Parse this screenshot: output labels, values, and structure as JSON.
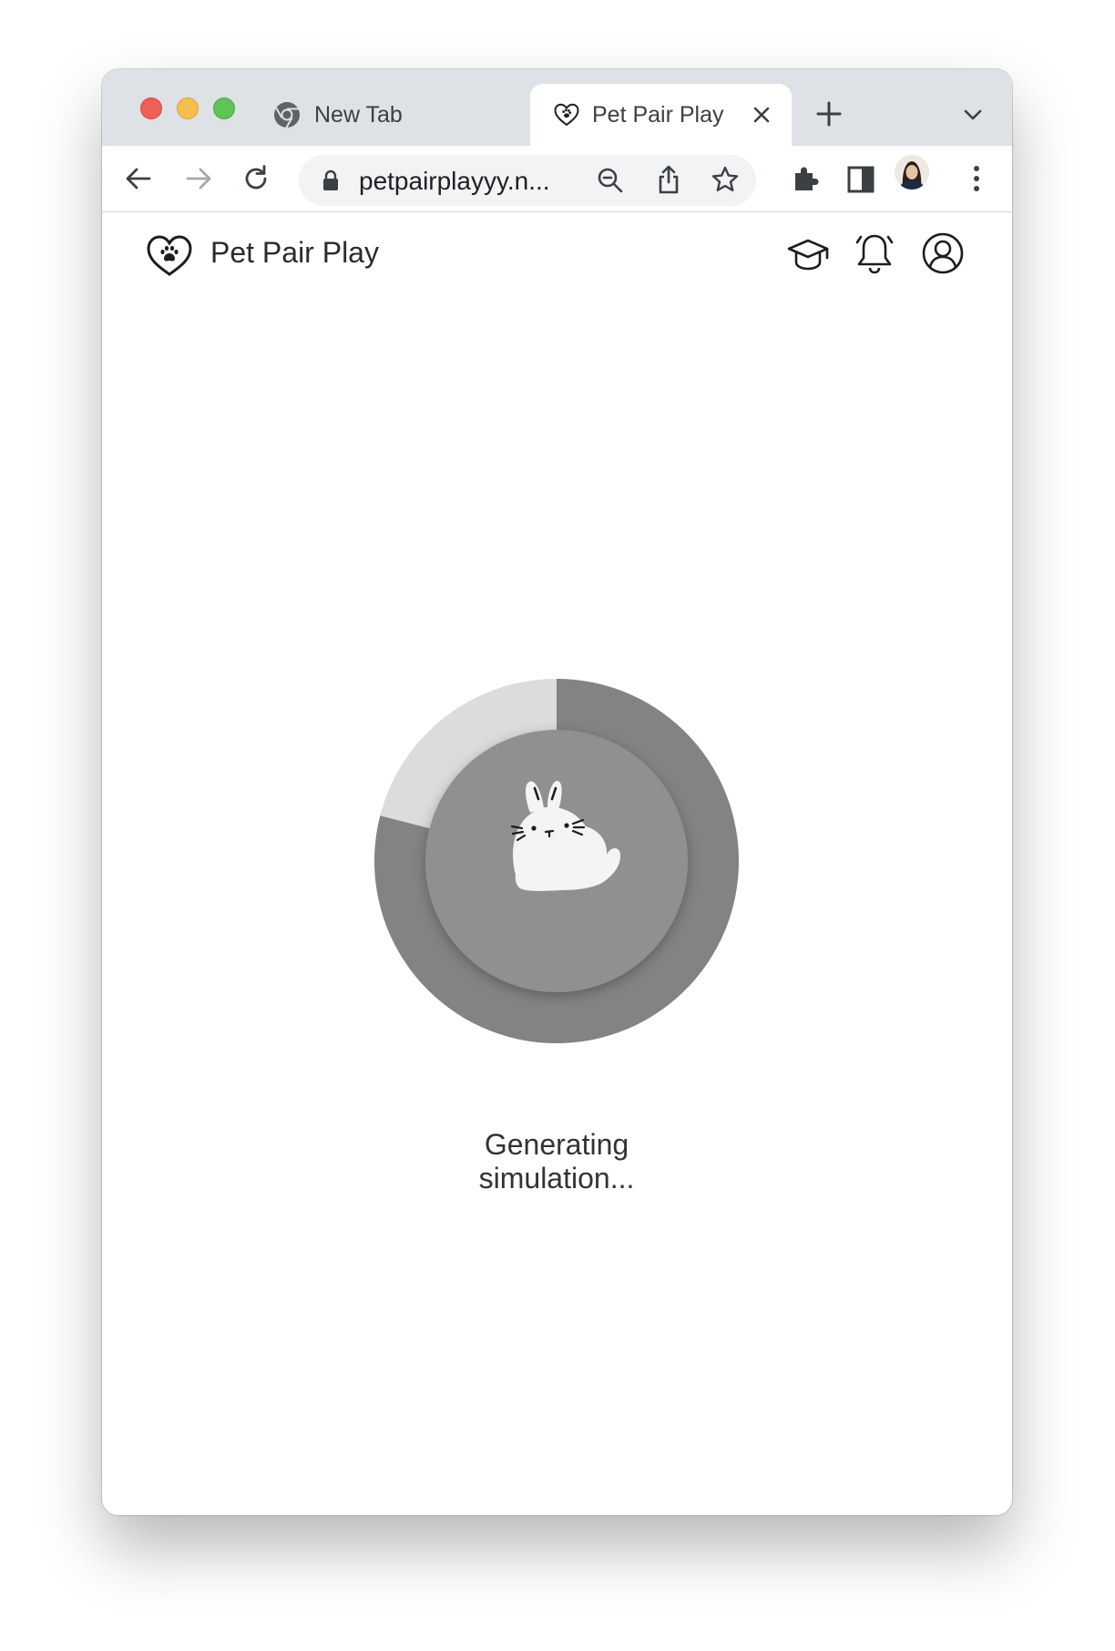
{
  "browser": {
    "tabs": [
      {
        "title": "New Tab",
        "favicon": "chrome-logo-icon",
        "active": false
      },
      {
        "title": "Pet Pair Play",
        "favicon": "heart-paw-icon",
        "active": true
      }
    ],
    "address_bar": {
      "url": "petpairplayyy.n...",
      "secure": true
    },
    "toolbar_icons": [
      "back-arrow-icon",
      "forward-arrow-icon",
      "reload-icon",
      "zoom-out-icon",
      "share-icon",
      "bookmark-star-icon",
      "extensions-puzzle-icon",
      "side-panel-icon",
      "profile-avatar",
      "more-menu-icon"
    ]
  },
  "app": {
    "brand_name": "Pet Pair Play",
    "header_icons": [
      "graduation-cap-icon",
      "notification-bell-icon",
      "account-user-icon"
    ]
  },
  "loader": {
    "progress_fraction": 0.79,
    "status_line1": "Generating",
    "status_line2": "simulation...",
    "mascot": "bunny",
    "colors": {
      "ring_track": "#dcdcdc",
      "ring_fill": "#838383",
      "inner_disc": "#909090",
      "mascot": "#f4f4f4"
    }
  }
}
